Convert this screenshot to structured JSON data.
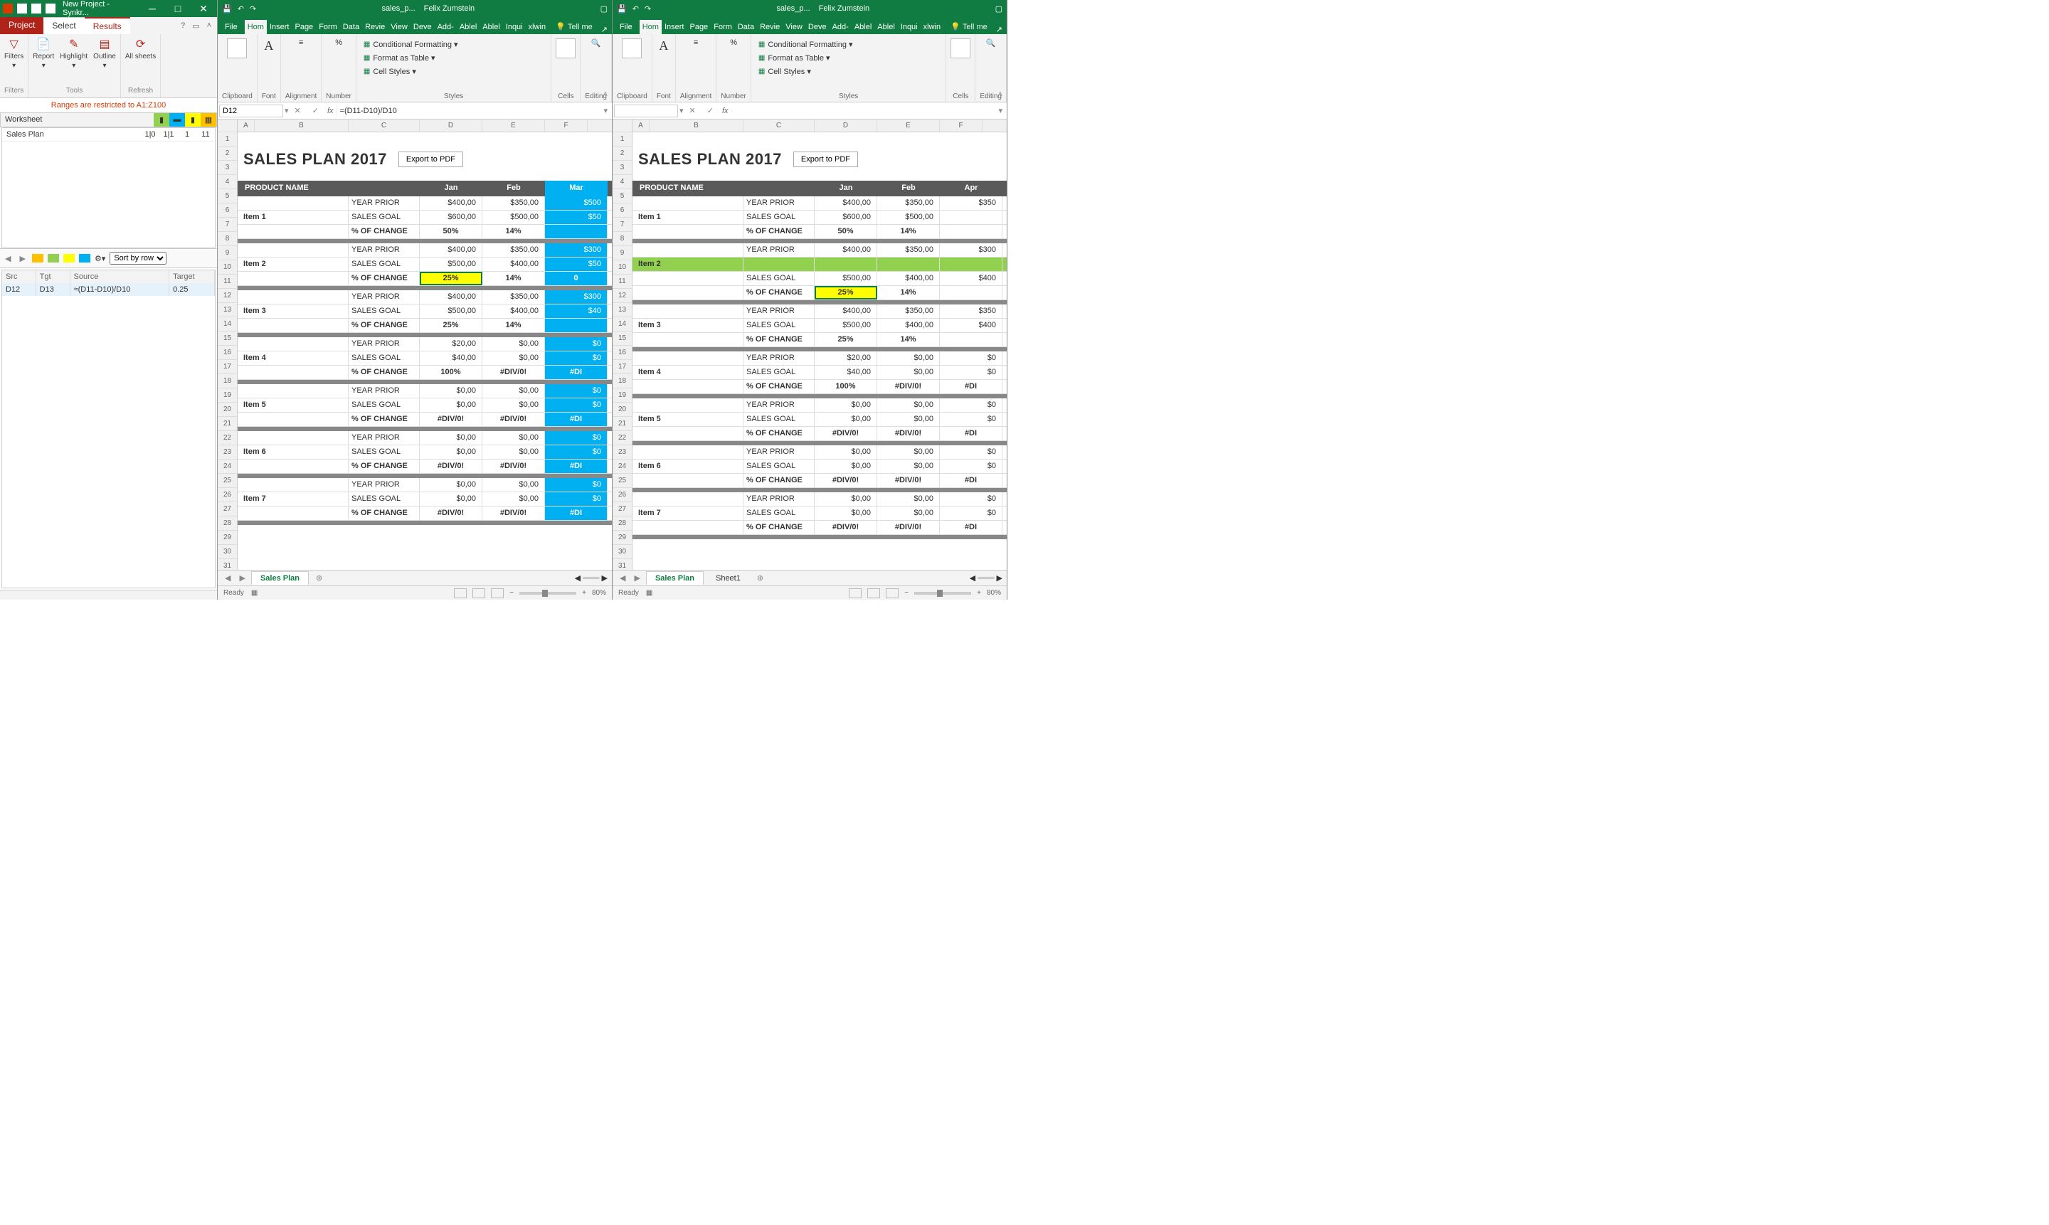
{
  "synk": {
    "title": "New Project - Synkr...",
    "tabs": {
      "project": "Project",
      "select": "Select",
      "results": "Results"
    },
    "ribbon": {
      "filters": "Filters",
      "report": "Report",
      "highlight": "Highlight",
      "outline": "Outline",
      "allsheets": "All sheets",
      "grp_filters": "Filters",
      "grp_tools": "Tools",
      "grp_refresh": "Refresh"
    },
    "warning": "Ranges are restricted to A1:Z100",
    "ws_header": "Worksheet",
    "ws_row": {
      "name": "Sales Plan",
      "c1": "1|0",
      "c2": "1|1",
      "c3": "1",
      "c4": "11"
    },
    "sort": "Sort by row",
    "diff_headers": {
      "src": "Src",
      "tgt": "Tgt",
      "source": "Source",
      "target": "Target"
    },
    "diff_row": {
      "src": "D12",
      "tgt": "D13",
      "source": "≈(D11-D10)/D10",
      "target": "0.25"
    }
  },
  "excel": {
    "qat": {
      "save": "💾",
      "undo": "↶",
      "redo": "↷"
    },
    "doc": "sales_p...",
    "user": "Felix Zumstein",
    "tabs": [
      "File",
      "Home",
      "Insert",
      "Page",
      "Form",
      "Data",
      "Revie",
      "View",
      "Deve",
      "Add-",
      "Ablel",
      "Ablel",
      "Inqui",
      "xlwin"
    ],
    "tellme": "Tell me",
    "ribbon": {
      "clipboard": "Clipboard",
      "font": "Font",
      "alignment": "Alignment",
      "number": "Number",
      "styles": "Styles",
      "cells": "Cells",
      "editing": "Editing",
      "cond": "Conditional Formatting",
      "fmt_table": "Format as Table",
      "cell_styles": "Cell Styles"
    },
    "name_box": "D12",
    "formula": "=(D11-D10)/D10",
    "cols": [
      "A",
      "B",
      "C",
      "D",
      "E",
      "F"
    ],
    "title": "SALES PLAN 2017",
    "export": "Export to PDF",
    "hdr": {
      "pn": "PRODUCT NAME",
      "m1": "Jan",
      "m2": "Feb",
      "m3_left": "Mar",
      "m3_right": "Apr"
    },
    "labels": {
      "yp": "YEAR PRIOR",
      "sg": "SALES GOAL",
      "pc": "% OF CHANGE"
    },
    "items": [
      {
        "name": "Item 1",
        "yp": [
          "$400,00",
          "$350,00",
          "$500"
        ],
        "sg": [
          "$600,00",
          "$500,00",
          "$50"
        ],
        "pc": [
          "50%",
          "14%",
          ""
        ]
      },
      {
        "name": "Item 2",
        "yp": [
          "$400,00",
          "$350,00",
          "$300"
        ],
        "sg": [
          "$500,00",
          "$400,00",
          "$50"
        ],
        "pc": [
          "25%",
          "14%",
          "0"
        ]
      },
      {
        "name": "Item 3",
        "yp": [
          "$400,00",
          "$350,00",
          "$300"
        ],
        "sg": [
          "$500,00",
          "$400,00",
          "$40"
        ],
        "pc": [
          "25%",
          "14%",
          ""
        ]
      },
      {
        "name": "Item 4",
        "yp": [
          "$20,00",
          "$0,00",
          "$0"
        ],
        "sg": [
          "$40,00",
          "$0,00",
          "$0"
        ],
        "pc": [
          "100%",
          "#DIV/0!",
          "#DI"
        ]
      },
      {
        "name": "Item 5",
        "yp": [
          "$0,00",
          "$0,00",
          "$0"
        ],
        "sg": [
          "$0,00",
          "$0,00",
          "$0"
        ],
        "pc": [
          "#DIV/0!",
          "#DIV/0!",
          "#DI"
        ]
      },
      {
        "name": "Item 6",
        "yp": [
          "$0,00",
          "$0,00",
          "$0"
        ],
        "sg": [
          "$0,00",
          "$0,00",
          "$0"
        ],
        "pc": [
          "#DIV/0!",
          "#DIV/0!",
          "#DI"
        ]
      },
      {
        "name": "Item 7",
        "yp": [
          "$0,00",
          "$0,00",
          "$0"
        ],
        "sg": [
          "$0,00",
          "$0,00",
          "$0"
        ],
        "pc": [
          "#DIV/0!",
          "#DIV/0!",
          "#DI"
        ]
      }
    ],
    "right_items": [
      {
        "name": "Item 1",
        "yp": [
          "$400,00",
          "$350,00",
          "$350"
        ],
        "sg": [
          "$600,00",
          "$500,00",
          ""
        ],
        "pc": [
          "50%",
          "14%",
          ""
        ]
      },
      {
        "name": "Item 2",
        "yp": [
          "$400,00",
          "$350,00",
          "$300"
        ],
        "sg": [
          "$500,00",
          "$400,00",
          "$400"
        ],
        "pc": [
          "25%",
          "14%",
          ""
        ]
      },
      {
        "name": "Item 3",
        "yp": [
          "$400,00",
          "$350,00",
          "$350"
        ],
        "sg": [
          "$500,00",
          "$400,00",
          "$400"
        ],
        "pc": [
          "25%",
          "14%",
          ""
        ]
      },
      {
        "name": "Item 4",
        "yp": [
          "$20,00",
          "$0,00",
          "$0"
        ],
        "sg": [
          "$40,00",
          "$0,00",
          "$0"
        ],
        "pc": [
          "100%",
          "#DIV/0!",
          "#DI"
        ]
      },
      {
        "name": "Item 5",
        "yp": [
          "$0,00",
          "$0,00",
          "$0"
        ],
        "sg": [
          "$0,00",
          "$0,00",
          "$0"
        ],
        "pc": [
          "#DIV/0!",
          "#DIV/0!",
          "#DI"
        ]
      },
      {
        "name": "Item 6",
        "yp": [
          "$0,00",
          "$0,00",
          "$0"
        ],
        "sg": [
          "$0,00",
          "$0,00",
          "$0"
        ],
        "pc": [
          "#DIV/0!",
          "#DIV/0!",
          "#DI"
        ]
      },
      {
        "name": "Item 7",
        "yp": [
          "$0,00",
          "$0,00",
          "$0"
        ],
        "sg": [
          "$0,00",
          "$0,00",
          "$0"
        ],
        "pc": [
          "#DIV/0!",
          "#DIV/0!",
          "#DI"
        ]
      }
    ],
    "sheets_left": [
      "Sales Plan"
    ],
    "sheets_right": [
      "Sales Plan",
      "Sheet1"
    ],
    "status": "Ready",
    "zoom": "80%"
  }
}
